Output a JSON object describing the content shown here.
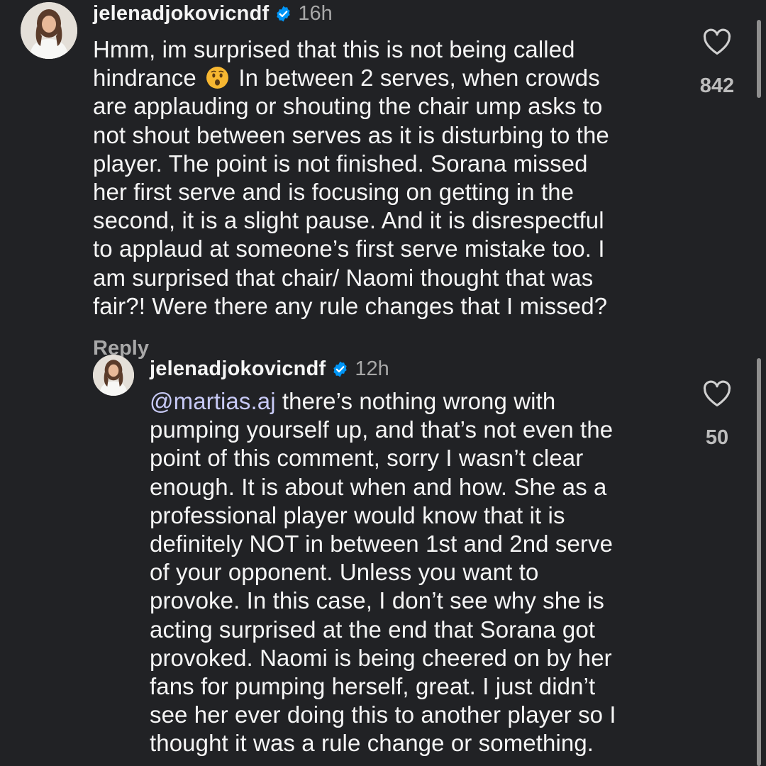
{
  "comment": {
    "username": "jelenadjokovicndf",
    "time": "16h",
    "text_before_emoji": "Hmm, im surprised that this is not being called\nhindrance ",
    "emoji": "hushed-face-emoji",
    "text_after_emoji": " In between 2 serves, when crowds\nare applauding or shouting the chair ump asks to\nnot shout between serves as it is disturbing to the\nplayer. The point is not finished. Sorana missed\nher first serve and is focusing on getting in the\nsecond, it is a slight pause. And it is disrespectful\nto applaud at someone’s first serve mistake too. I\nam surprised that chair/ Naomi thought that was\nfair?! Were there any rule changes that I missed?",
    "likes": "842",
    "reply_label": "Reply"
  },
  "reply": {
    "username": "jelenadjokovicndf",
    "time": "12h",
    "mention": "@martias.aj",
    "text": " there’s nothing wrong with\npumping yourself up, and that’s not even the\npoint of this comment, sorry I wasn’t clear\nenough. It is about when and how. She as a\nprofessional player would know that it is\ndefinitely NOT in between 1st and 2nd serve\nof your opponent. Unless you want to\nprovoke. In this case, I don’t see why she is\nacting surprised at the end that Sorana got\nprovoked. Naomi is being cheered on by her\nfans for pumping herself, great. I just didn’t\nsee her ever doing this to another player so I\nthought it was a rule change or something.",
    "likes": "50"
  },
  "icons": {
    "verified": "verified-badge-icon",
    "like": "heart-outline-icon"
  },
  "colors": {
    "background": "#212225",
    "verified_blue": "#0095f6",
    "mention": "#c7c9f5",
    "muted": "#a8a8a8"
  }
}
